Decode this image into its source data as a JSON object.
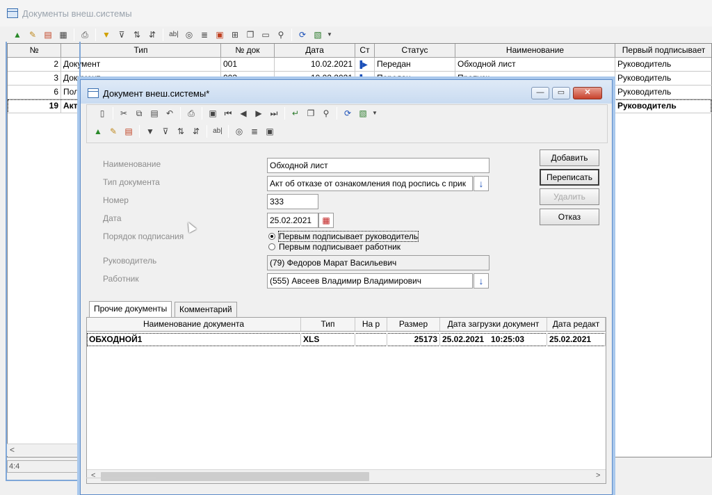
{
  "bg_window": {
    "title": "Документы внеш.системы",
    "columns": [
      "№",
      "Тип",
      "№ док",
      "Дата",
      "Ст",
      "Статус",
      "Наименование",
      "Первый подписывает"
    ],
    "rows": [
      {
        "num": "2",
        "type": "Документ",
        "doc_num": "001",
        "date": "10.02.2021",
        "status": "Передан",
        "name": "Обходной лист",
        "first_signer": "Руководитель"
      },
      {
        "num": "3",
        "type": "Документ",
        "doc_num": "003",
        "date": "10.02.2021",
        "status": "Передан",
        "name": "Пропуск",
        "first_signer": "Руководитель"
      },
      {
        "num": "6",
        "type": "Поло",
        "doc_num": "",
        "date": "",
        "status": "",
        "name": "",
        "first_signer": "Руководитель"
      },
      {
        "num": "19",
        "type": "Акт",
        "doc_num": "",
        "date": "",
        "status": "",
        "name": "",
        "first_signer": "Руководитель"
      }
    ],
    "status_text": "4:4",
    "scroll_left": "<"
  },
  "dialog": {
    "title": "Документ внеш.системы*",
    "controls": {
      "minimize": "—",
      "maximize": "▭",
      "close": "✕"
    },
    "form": {
      "name_label": "Наименование",
      "name_value": "Обходной лист",
      "doctype_label": "Тип документа",
      "doctype_value": "Акт об отказе от ознакомления под роспись с прик",
      "number_label": "Номер",
      "number_value": "333",
      "date_label": "Дата",
      "date_value": "25.02.2021",
      "order_label": "Порядок подписания",
      "order_option_1": "Первым подписывает руководитель",
      "order_option_2": "Первым подписывает работник",
      "manager_label": "Руководитель",
      "manager_value": "(79) Федоров Марат Васильевич",
      "employee_label": "Работник",
      "employee_value": "(555) Авсеев Владимир Владимирович"
    },
    "buttons": {
      "add": "Добавить",
      "rewrite": "Переписать",
      "delete": "Удалить",
      "cancel": "Отказ"
    },
    "tabs": [
      "Прочие документы",
      "Комментарий"
    ],
    "subgrid": {
      "columns": [
        "Наименование документа",
        "Тип",
        "На р",
        "Размер",
        "Дата загрузки документ",
        "Дата редакт"
      ],
      "row": {
        "name": "ОБХОДНОЙ1",
        "type": "XLS",
        "on_r": "",
        "size": "25173",
        "upload_date": "25.02.2021   10:25:03",
        "edit_date": "25.02.2021"
      }
    }
  },
  "colors": {
    "accent_blue": "#1a4fb8",
    "frame_blue": "#7fa7d8",
    "close_red": "#c8422b"
  }
}
